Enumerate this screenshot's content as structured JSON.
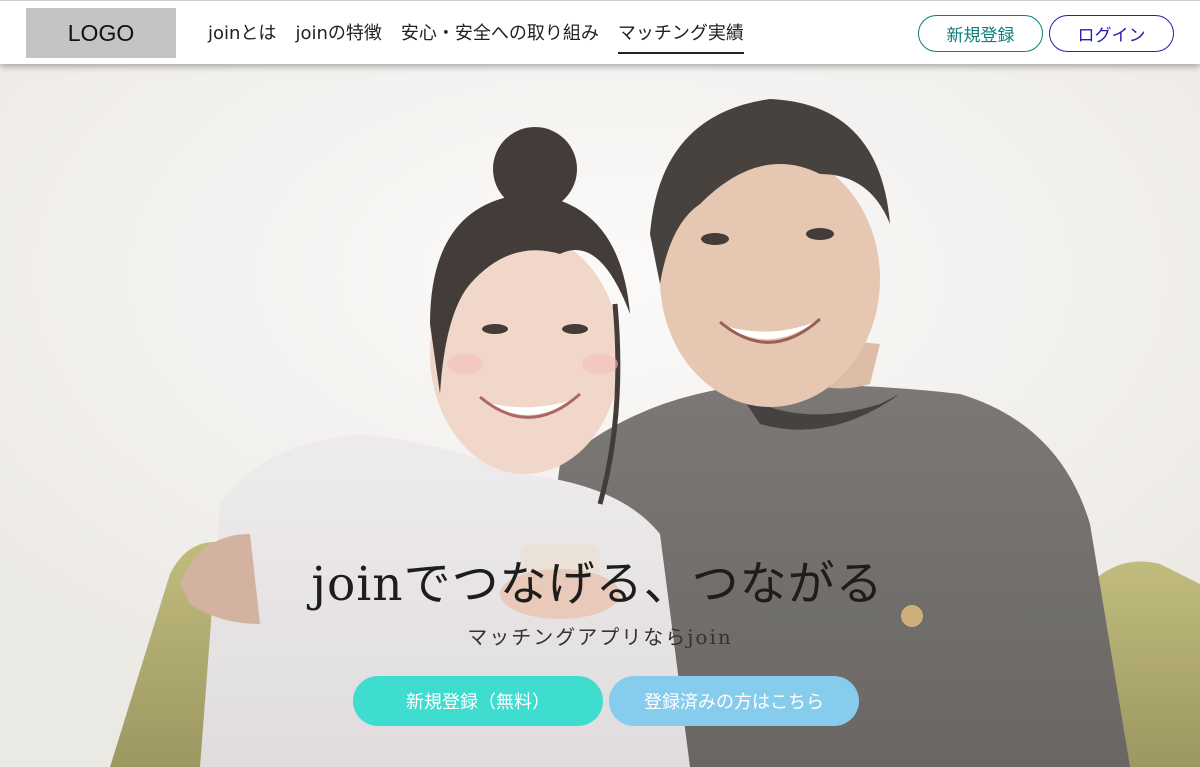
{
  "header": {
    "logo_text": "LOGO",
    "nav": [
      {
        "label": "joinとは"
      },
      {
        "label": "joinの特徴"
      },
      {
        "label": "安心・安全への取り組み"
      },
      {
        "label": "マッチング実績"
      }
    ],
    "signup_label": "新規登録",
    "login_label": "ログイン"
  },
  "hero": {
    "title": "joinでつなげる、つながる",
    "subtitle": "マッチングアプリならjoin",
    "primary_cta": "新規登録（無料）",
    "secondary_cta": "登録済みの方はこちら"
  },
  "colors": {
    "signup_border": "#0d7c7a",
    "login_border": "#2420b8",
    "cta_primary": "#3fdcd0",
    "cta_secondary": "#86ccec"
  }
}
